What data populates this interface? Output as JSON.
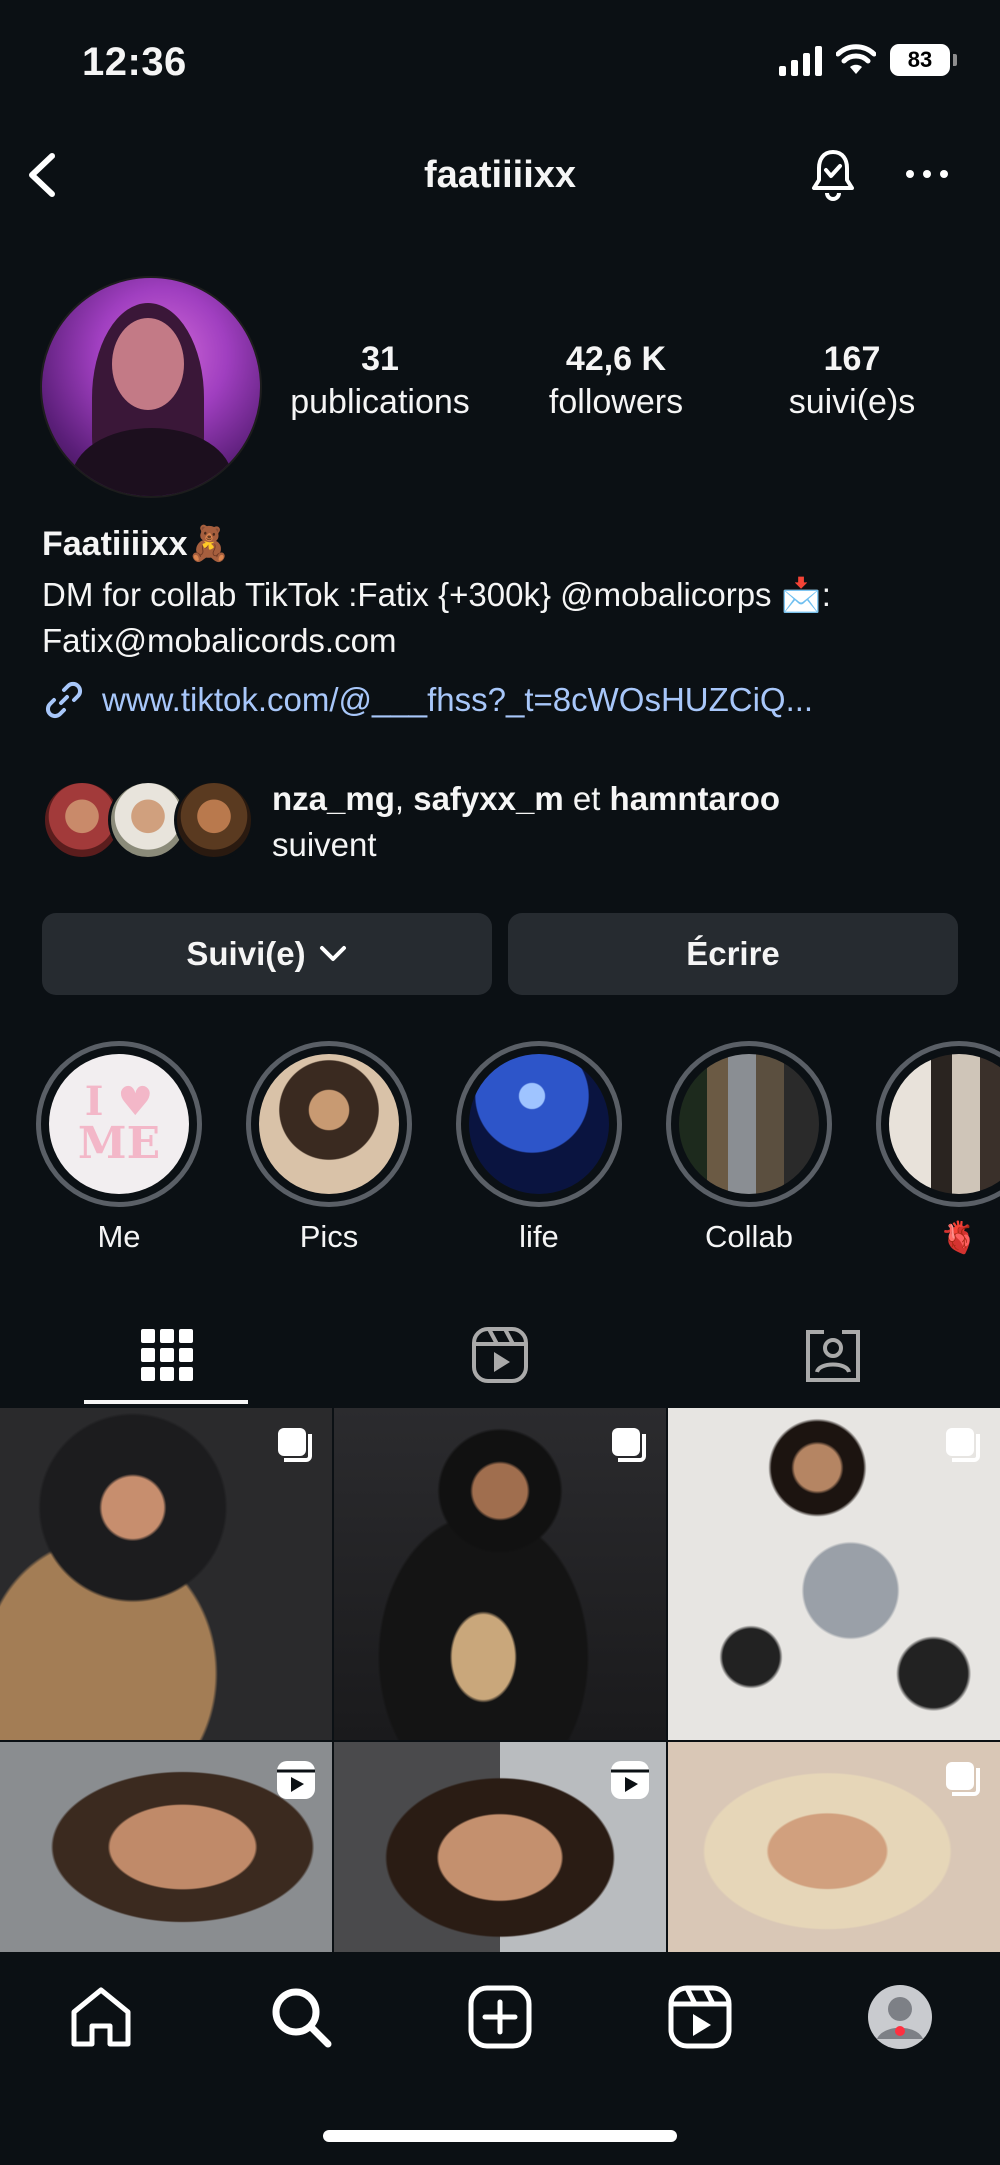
{
  "status_bar": {
    "time": "12:36",
    "battery": "83"
  },
  "nav": {
    "username": "faatiiiixx"
  },
  "profile": {
    "stats": [
      {
        "value": "31",
        "label": "publications"
      },
      {
        "value": "42,6 K",
        "label": "followers"
      },
      {
        "value": "167",
        "label": "suivi(e)s"
      }
    ],
    "display_name": "Faatiiiixx🧸",
    "bio_line1": "DM for collab TikTok :Fatix {+300k} @mobalicorps 📩:",
    "bio_line2": "Fatix@mobalicords.com",
    "link": "www.tiktok.com/@___fhss?_t=8cWOsHUZCiQ..."
  },
  "followed_by": {
    "user1": "nza_mg",
    "sep": ", ",
    "user2": "safyxx_m",
    "and": " et ",
    "user3": "hamntaroo",
    "suffix": "suivent"
  },
  "buttons": {
    "following": "Suivi(e)",
    "message": "Écrire"
  },
  "highlights": [
    {
      "label": "Me"
    },
    {
      "label": "Pics"
    },
    {
      "label": "life"
    },
    {
      "label": "Collab"
    },
    {
      "label": "🫀"
    }
  ],
  "highlight_me_text": {
    "line1": "I",
    "line2": "ME"
  },
  "tabs": {
    "active": "grid"
  },
  "icons": {
    "back": "chevron-left-icon",
    "bell": "bell-icon",
    "more": "more-horizontal-icon",
    "grid": "grid-icon",
    "reels": "reels-icon",
    "tagged": "tagged-icon",
    "home": "home-icon",
    "search": "search-icon",
    "create": "create-icon",
    "profile": "profile-icon"
  },
  "colors": {
    "background": "#0b1014",
    "button": "#262b30",
    "link": "#a8c7fa",
    "notification": "#ff3040"
  }
}
